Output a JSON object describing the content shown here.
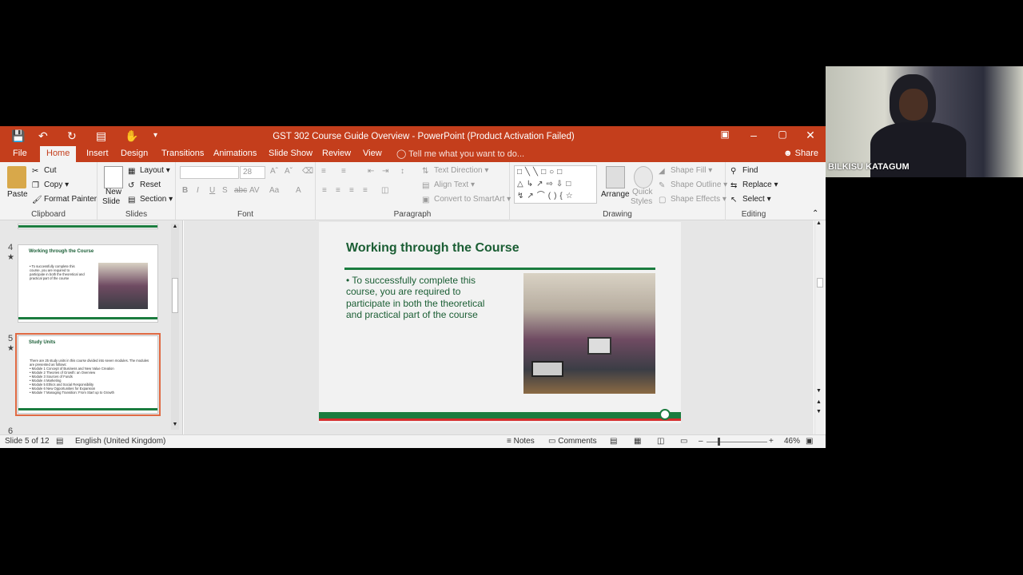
{
  "window": {
    "title": "GST 302 Course Guide Overview - PowerPoint (Product Activation Failed)"
  },
  "tabs": [
    {
      "label": "File"
    },
    {
      "label": "Home"
    },
    {
      "label": "Insert"
    },
    {
      "label": "Design"
    },
    {
      "label": "Transitions"
    },
    {
      "label": "Animations"
    },
    {
      "label": "Slide Show"
    },
    {
      "label": "Review"
    },
    {
      "label": "View"
    }
  ],
  "tell_me": "Tell me what you want to do...",
  "share": "Share",
  "ribbon": {
    "clipboard": {
      "label": "Clipboard",
      "paste": "Paste",
      "cut": "Cut",
      "copy": "Copy",
      "format_painter": "Format Painter"
    },
    "slides": {
      "label": "Slides",
      "new_slide_1": "New",
      "new_slide_2": "Slide",
      "layout": "Layout",
      "reset": "Reset",
      "section": "Section"
    },
    "font": {
      "label": "Font",
      "size": "28"
    },
    "paragraph": {
      "label": "Paragraph",
      "text_direction": "Text Direction",
      "align_text": "Align Text",
      "convert_smartart": "Convert to SmartArt"
    },
    "drawing": {
      "label": "Drawing",
      "arrange": "Arrange",
      "quick_styles_1": "Quick",
      "quick_styles_2": "Styles",
      "shape_fill": "Shape Fill",
      "shape_outline": "Shape Outline",
      "shape_effects": "Shape Effects"
    },
    "editing": {
      "label": "Editing",
      "find": "Find",
      "replace": "Replace",
      "select": "Select"
    }
  },
  "thumbnails": [
    {
      "num": "4",
      "title": "Working through the Course",
      "text": "• To successfully complete this course, you are required to participate in both the theoretical and practical part of the course"
    },
    {
      "num": "5",
      "title": "Study Units",
      "text": "There are 25 study units in this course divided into seven modules. The modules are presented as follows:\n• Module 1 Concept of Business and New Value Creation\n• Module 2 Theories of Growth: an Overview\n• Module 3 Sources of Funds\n• Module 4 Marketing\n• Module 5 Ethics and Social Responsibility\n• Module 6 New Opportunities for Expansion\n• Module 7 Managing Transition: From Start up to Growth"
    },
    {
      "num": "6"
    }
  ],
  "slide": {
    "title": "Working through the Course",
    "body": "• To successfully complete this course, you are required to participate in both the theoretical and practical part of the course"
  },
  "status": {
    "slide_of": "Slide 5 of 12",
    "language": "English (United Kingdom)",
    "notes": "Notes",
    "comments": "Comments",
    "zoom": "46%"
  },
  "video": {
    "name": "BILKISU KATAGUM"
  },
  "colors": {
    "accent": "#c43e1c",
    "slide_green": "#1b7c3f",
    "slide_text": "#1b5e34"
  }
}
